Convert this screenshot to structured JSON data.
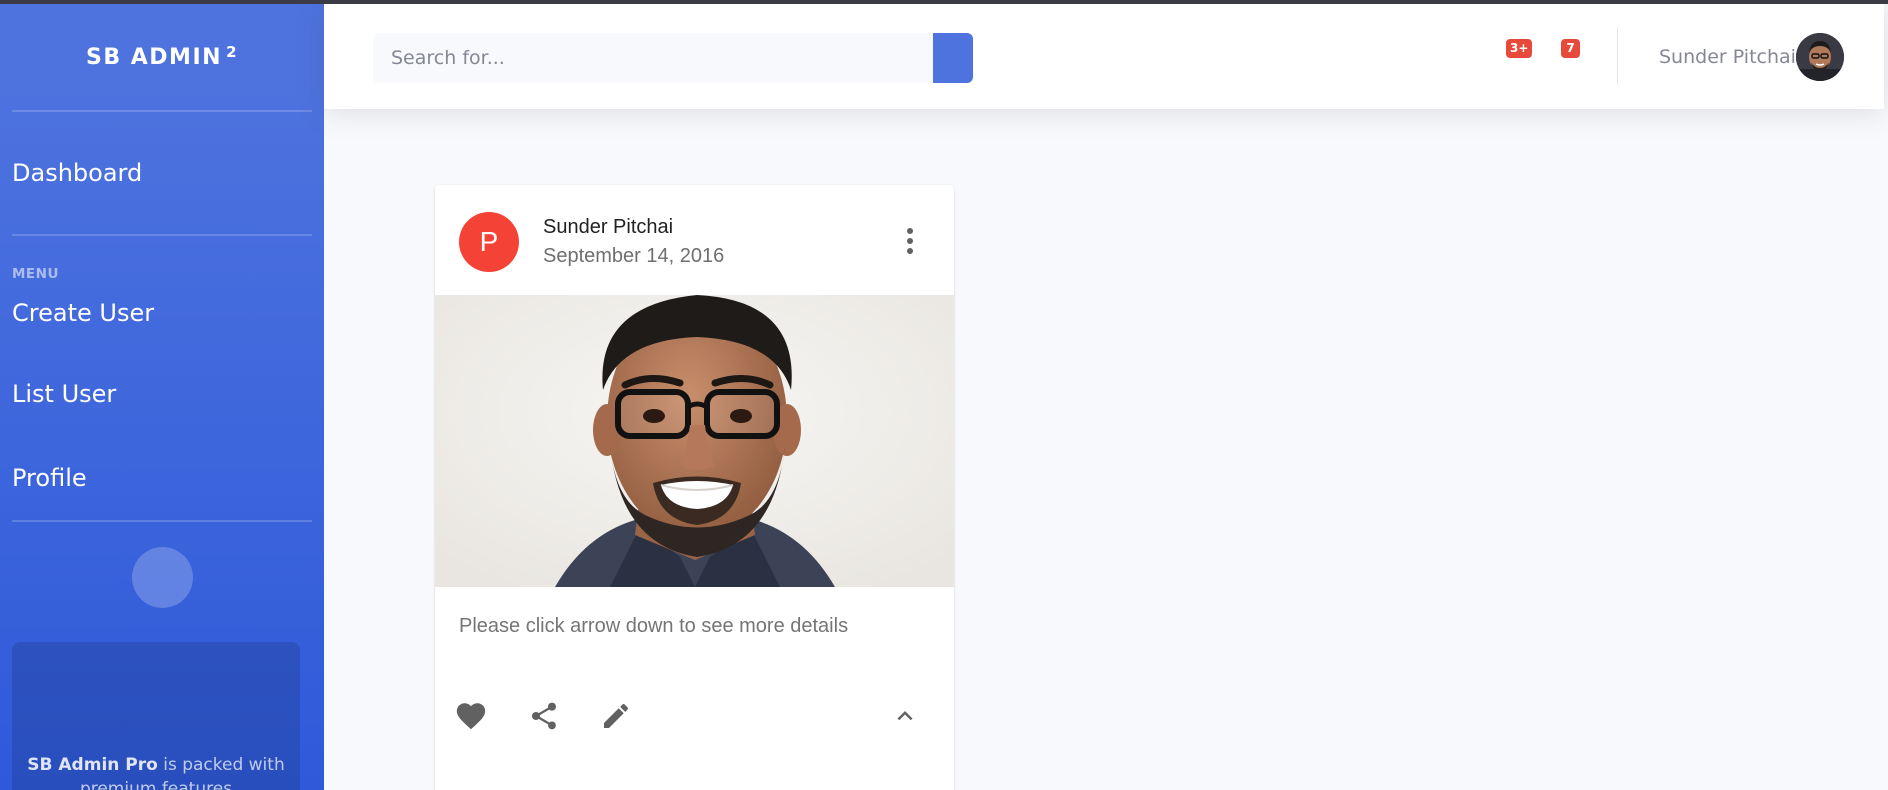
{
  "sidebar": {
    "brand": "SB ADMIN",
    "brand_sup": "2",
    "items": {
      "dashboard": "Dashboard",
      "heading": "MENU",
      "create_user": "Create User",
      "list_user": "List User",
      "profile": "Profile"
    },
    "toggler_glyph": "",
    "promo": {
      "bold": "SB Admin Pro",
      "text": " is packed with premium features"
    }
  },
  "topbar": {
    "search_placeholder": "Search for...",
    "alerts_count": "3+",
    "messages_count": "7",
    "user_name": "Sunder Pitchai"
  },
  "card": {
    "avatar_letter": "P",
    "title": "Sunder Pitchai",
    "subheader": "September 14, 2016",
    "text": "Please click arrow down to see more details"
  },
  "colors": {
    "primary": "#4e73df",
    "badge": "#e74a3b",
    "avatar": "#f44336"
  }
}
